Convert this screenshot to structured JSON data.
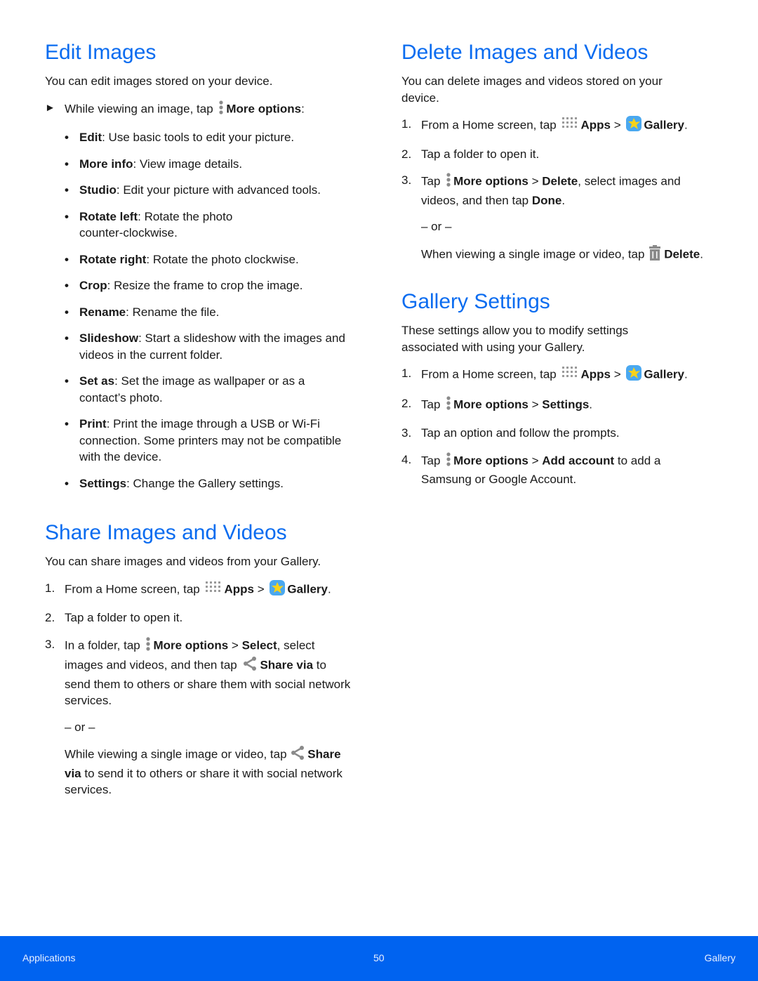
{
  "edit": {
    "title": "Edit Images",
    "intro": "You can edit images stored on your device.",
    "lead": {
      "pre": "While viewing an image, tap ",
      "bold": "More options",
      "post": ":"
    },
    "items": [
      {
        "bold": "Edit",
        "text": ": Use basic tools to edit your picture."
      },
      {
        "bold": "More info",
        "text": ": View image details."
      },
      {
        "bold": "Studio",
        "text": ": Edit your picture with advanced tools."
      },
      {
        "bold": "Rotate left",
        "text": ": Rotate the photo counter-clockwise."
      },
      {
        "bold": "Rotate right",
        "text": ": Rotate the photo clockwise."
      },
      {
        "bold": "Crop",
        "text": ": Resize the frame to crop the image."
      },
      {
        "bold": "Rename",
        "text": ": Rename the file."
      },
      {
        "bold": "Slideshow",
        "text": ": Start a slideshow with the images and videos in the current folder."
      },
      {
        "bold": "Set as",
        "text": ": Set the image as wallpaper or as a contact’s photo."
      },
      {
        "bold": "Print",
        "text": ": Print the image through a USB or Wi-Fi connection. Some printers may not be compatible with the device."
      },
      {
        "bold": "Settings",
        "text": ": Change the Gallery settings."
      }
    ]
  },
  "share": {
    "title": "Share Images and Videos",
    "intro": "You can share images and videos from your Gallery.",
    "step1": {
      "num": "1.",
      "pre": "From a Home screen, tap ",
      "apps": "Apps",
      "sep": " > ",
      "gallery": "Gallery",
      "post": "."
    },
    "step2": {
      "num": "2.",
      "text": "Tap a folder to open it."
    },
    "step3": {
      "num": "3.",
      "pre": "In a folder, tap ",
      "more": "More options",
      "sep": " > ",
      "select": "Select",
      "mid": ", select images and videos, and then tap ",
      "share": "Share via",
      "post": " to send them to others or share them with social network services."
    },
    "or": "– or –",
    "alt": {
      "pre": "While viewing a single image or video, tap ",
      "share": "Share via",
      "post": " to send it to others or share it with social network services."
    }
  },
  "delete": {
    "title": "Delete Images and Videos",
    "intro": "You can delete images and videos stored on your device.",
    "step1": {
      "num": "1.",
      "pre": "From a Home screen, tap ",
      "apps": "Apps",
      "sep": " > ",
      "gallery": "Gallery",
      "post": "."
    },
    "step2": {
      "num": "2.",
      "text": "Tap a folder to open it."
    },
    "step3": {
      "num": "3.",
      "pre": "Tap ",
      "more": "More options",
      "sep": " > ",
      "del": "Delete",
      "mid": ", select images and videos, and then tap ",
      "done": "Done",
      "post": "."
    },
    "or": "– or –",
    "alt": {
      "pre": "When viewing a single image or video, tap ",
      "del": "Delete",
      "post": "."
    }
  },
  "settings": {
    "title": "Gallery Settings",
    "intro": "These settings allow you to modify settings associated with using your Gallery.",
    "step1": {
      "num": "1.",
      "pre": "From a Home screen, tap ",
      "apps": "Apps",
      "sep": " > ",
      "gallery": "Gallery",
      "post": "."
    },
    "step2": {
      "num": "2.",
      "pre": "Tap ",
      "more": "More options",
      "sep": " > ",
      "settings": "Settings",
      "post": "."
    },
    "step3": {
      "num": "3.",
      "text": "Tap an option and follow the prompts."
    },
    "step4": {
      "num": "4.",
      "pre": "Tap ",
      "more": "More options",
      "sep": " > ",
      "add": "Add account",
      "post": " to add a Samsung or Google Account."
    }
  },
  "footer": {
    "left": "Applications",
    "page": "50",
    "right": "Gallery"
  },
  "icons": {
    "more": "more-options-icon",
    "apps": "apps-grid-icon",
    "gallery": "gallery-app-icon",
    "share": "share-icon",
    "trash": "trash-icon"
  },
  "colors": {
    "heading": "#0a6cf0",
    "footer": "#0063f0"
  }
}
